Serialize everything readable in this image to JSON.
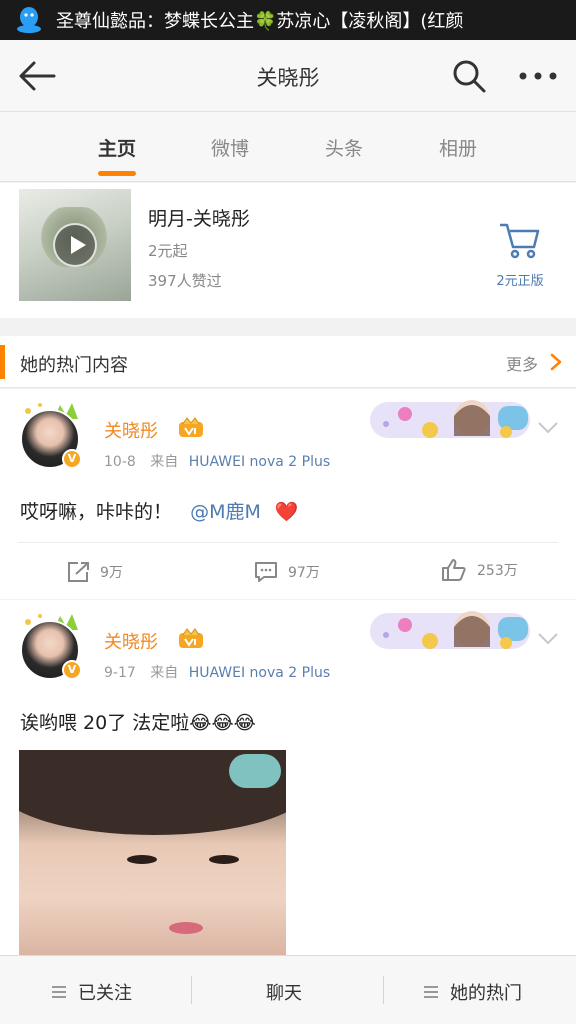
{
  "status_bar": {
    "marquee": "圣尊仙懿品：梦蝶长公主🍀苏凉心【凌秋阁】(红颜"
  },
  "nav": {
    "title": "关晓彤"
  },
  "tabs": [
    {
      "label": "主页"
    },
    {
      "label": "微博"
    },
    {
      "label": "头条"
    },
    {
      "label": "相册"
    }
  ],
  "music": {
    "song": "明月-关晓彤",
    "price": "2元起",
    "likes": "397人赞过",
    "buy_label": "2元正版"
  },
  "hot": {
    "title": "她的热门内容",
    "more": "更多"
  },
  "posts": [
    {
      "name": "关晓彤",
      "date": "10-8",
      "from": "来自",
      "source": "HUAWEI nova 2 Plus",
      "text": "哎呀嘛，咔咔的！",
      "mention": "@M鹿M",
      "emoji": "❤️",
      "reposts": "9万",
      "comments": "97万",
      "likes": "253万"
    },
    {
      "name": "关晓彤",
      "date": "9-17",
      "from": "来自",
      "source": "HUAWEI nova 2 Plus",
      "text": "诶哟喂 20了 法定啦😂😂😂"
    }
  ],
  "bottom": [
    {
      "label": "已关注"
    },
    {
      "label": "聊天"
    },
    {
      "label": "她的热门"
    }
  ],
  "colors": {
    "accent": "#ff8200",
    "link": "#4e7bb0",
    "name": "#f08a24"
  }
}
